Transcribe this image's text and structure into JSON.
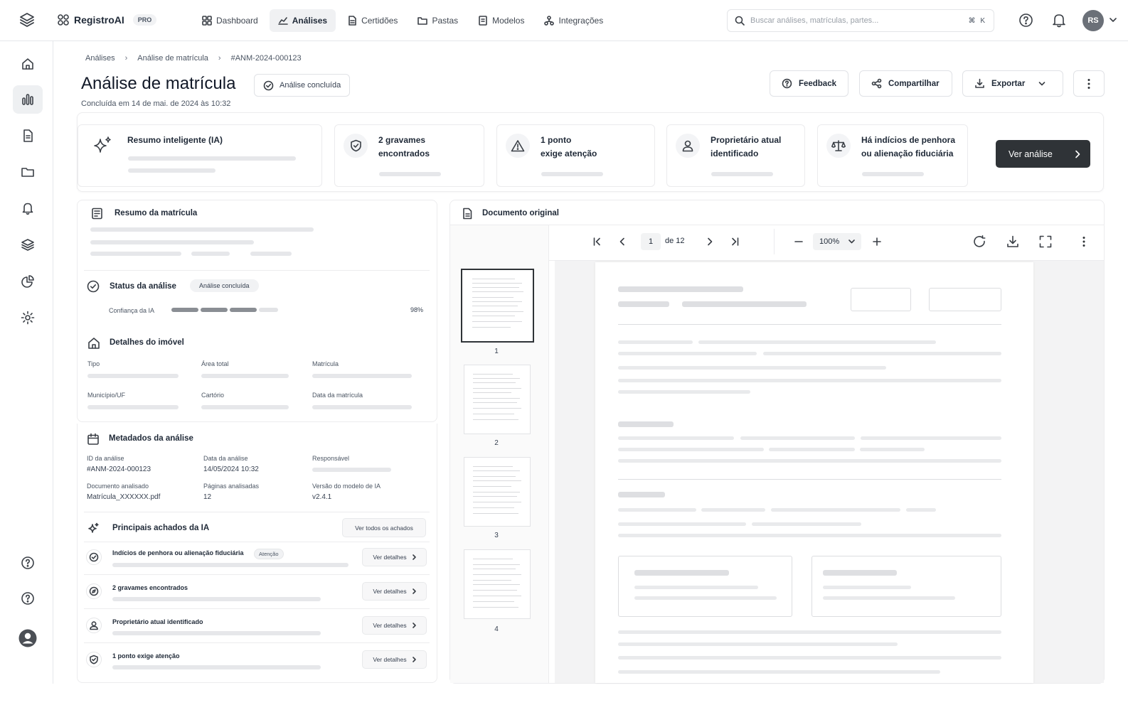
{
  "app": {
    "name": "RegistroAI",
    "plan_badge": "PRO"
  },
  "nav": [
    {
      "label": "Dashboard",
      "icon": "dashboard-icon"
    },
    {
      "label": "Análises",
      "icon": "analysis-icon",
      "active": true
    },
    {
      "label": "Certidões",
      "icon": "certificate-icon"
    },
    {
      "label": "Pastas",
      "icon": "folder-icon"
    },
    {
      "label": "Modelos",
      "icon": "template-icon"
    },
    {
      "label": "Integrações",
      "icon": "integration-icon"
    }
  ],
  "search": {
    "placeholder": "Buscar análises, matrículas, partes...",
    "shortcut": "⌘ K"
  },
  "user": {
    "initials": "RS"
  },
  "breadcrumb": [
    "Análises",
    "Análise de matrícula",
    "#ANM-2024-000123"
  ],
  "page": {
    "title": "Análise de matrícula",
    "status": "Análise concluída",
    "subtitle": "Concluída em 14 de mai. de 2024 às 10:32"
  },
  "actions": {
    "feedback": "Feedback",
    "share": "Compartilhar",
    "export": "Exportar"
  },
  "summary_cards": [
    {
      "line1": "Resumo inteligente (IA)",
      "line2": "",
      "icon": "sparkle-icon"
    },
    {
      "line1": "2 gravames",
      "line2": "encontrados",
      "icon": "shield-icon"
    },
    {
      "line1": "1 ponto",
      "line2": "exige atenção",
      "icon": "warning-icon"
    },
    {
      "line1": "Proprietário atual",
      "line2": "identificado",
      "icon": "user-icon"
    },
    {
      "line1": "Há indícios de penhora",
      "line2": "ou alienação fiduciária",
      "icon": "scale-icon"
    }
  ],
  "cta": "Ver análise",
  "left": {
    "resumo_title": "Resumo da matrícula",
    "status_title": "Status da análise",
    "status_tag": "Análise concluída",
    "confidence_label": "Confiança da IA",
    "confidence_value": "98%",
    "confidence": 0.98,
    "detalhes_title": "Detalhes do imóvel",
    "detalhes_fields": [
      "Tipo",
      "Área total",
      "Matrícula",
      "Município/UF",
      "Cartório",
      "Data da matrícula"
    ],
    "meta_title": "Metadados da análise",
    "meta": {
      "id_label": "ID da análise",
      "id_value": "#ANM-2024-000123",
      "date_label": "Data da análise",
      "date_value": "14/05/2024 10:32",
      "resp_label": "Responsável",
      "doc_label": "Documento analisado",
      "doc_value": "Matrícula_XXXXXX.pdf",
      "pages_label": "Páginas analisadas",
      "pages_value": "12",
      "model_label": "Versão do modelo de IA",
      "model_value": "v2.4.1"
    },
    "findings_title": "Principais achados da IA",
    "findings_all": "Ver todos os achados",
    "findings": [
      {
        "title": "Indícios de penhora ou alienação fiduciária",
        "badge": "Atenção",
        "action": "Ver detalhes",
        "icon": "check-circle-icon"
      },
      {
        "title": "2 gravames encontrados",
        "action": "Ver detalhes",
        "icon": "compass-icon"
      },
      {
        "title": "Proprietário atual identificado",
        "action": "Ver detalhes",
        "icon": "user-icon"
      },
      {
        "title": "1 ponto exige atenção",
        "action": "Ver detalhes",
        "icon": "shield-check-icon"
      }
    ]
  },
  "viewer": {
    "title": "Documento original",
    "page": "1",
    "of": "de 12",
    "zoom": "100%",
    "thumbs": [
      "1",
      "2",
      "3",
      "4"
    ]
  }
}
